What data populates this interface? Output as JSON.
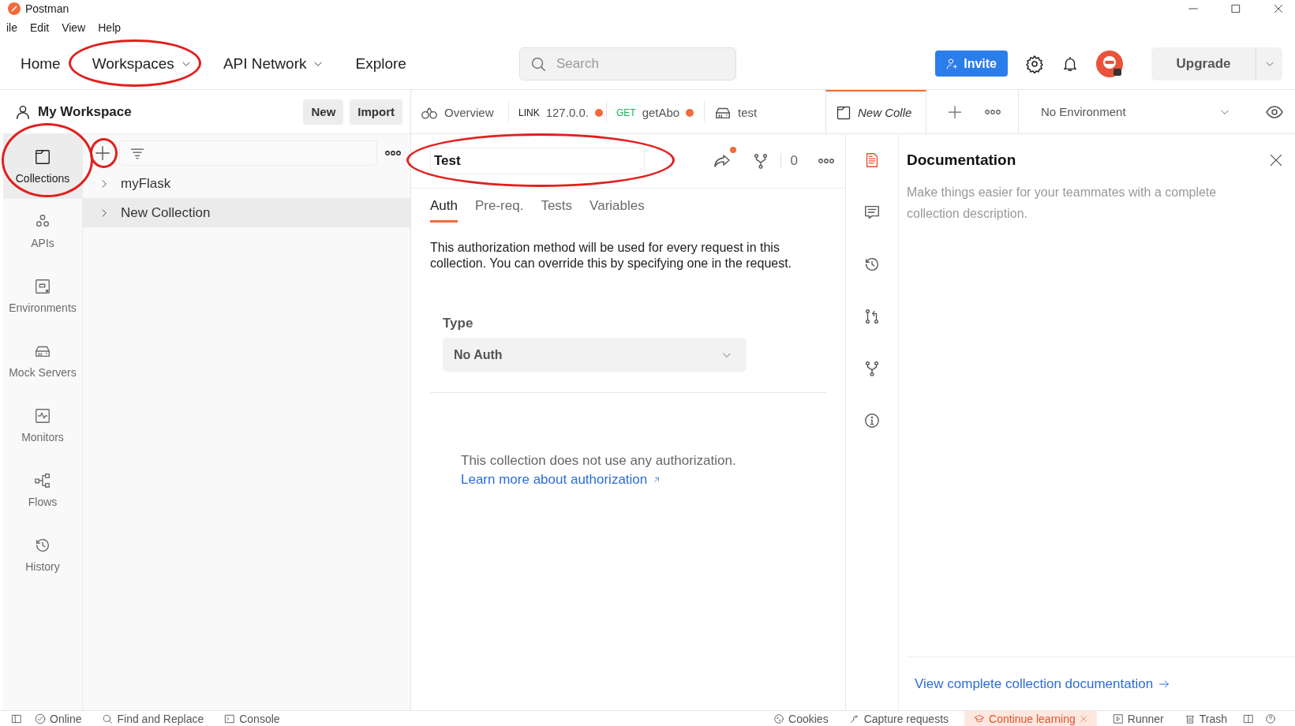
{
  "window": {
    "title": "Postman"
  },
  "menu": [
    "ile",
    "Edit",
    "View",
    "Help"
  ],
  "nav": {
    "items": [
      {
        "label": "Home",
        "dropdown": false,
        "circled": false
      },
      {
        "label": "Workspaces",
        "dropdown": true,
        "circled": true
      },
      {
        "label": "API Network",
        "dropdown": true,
        "circled": false
      },
      {
        "label": "Explore",
        "dropdown": false,
        "circled": false
      }
    ],
    "search": {
      "placeholder": "Search"
    },
    "invite": "Invite",
    "upgrade": "Upgrade"
  },
  "workspace": {
    "name": "My Workspace",
    "buttons": [
      "New",
      "Import"
    ]
  },
  "rail": [
    {
      "kind": "collections",
      "label": "Collections",
      "selected": true,
      "circled": true
    },
    {
      "kind": "apis",
      "label": "APIs",
      "selected": false,
      "circled": false
    },
    {
      "kind": "environments",
      "label": "Environments",
      "selected": false,
      "circled": false
    },
    {
      "kind": "mock",
      "label": "Mock Servers",
      "selected": false,
      "circled": false
    },
    {
      "kind": "monitors",
      "label": "Monitors",
      "selected": false,
      "circled": false
    },
    {
      "kind": "flows",
      "label": "Flows",
      "selected": false,
      "circled": false
    },
    {
      "kind": "history",
      "label": "History",
      "selected": false,
      "circled": false
    }
  ],
  "collections": {
    "add_circled": true,
    "items": [
      {
        "name": "myFlask",
        "selected": false
      },
      {
        "name": "New Collection",
        "selected": true
      }
    ]
  },
  "tabs": [
    {
      "kind": "overview",
      "label": "Overview",
      "selected": false,
      "unsaved": false
    },
    {
      "kind": "request",
      "method": "LINK",
      "color": "#212121",
      "label": "127.0.0.",
      "selected": false,
      "unsaved": true
    },
    {
      "kind": "request",
      "method": "GET",
      "color": "#0cbb52",
      "label": "getAbo",
      "selected": false,
      "unsaved": true
    },
    {
      "kind": "mock",
      "label": "test",
      "selected": false,
      "unsaved": false
    },
    {
      "kind": "collection",
      "label": "New Colle",
      "selected": true,
      "unsaved": false
    }
  ],
  "environment": "No Environment",
  "editor": {
    "title": "Test",
    "title_circled": true,
    "share_unsaved": true,
    "fork_count": "0",
    "subtabs": [
      {
        "label": "Auth",
        "selected": true
      },
      {
        "label": "Pre-req.",
        "selected": false
      },
      {
        "label": "Tests",
        "selected": false
      },
      {
        "label": "Variables",
        "selected": false
      }
    ],
    "description": "This authorization method will be used for every request in this collection. You can override this by specifying one in the request.",
    "type_label": "Type",
    "type_value": "No Auth",
    "note": "This collection does not use any authorization.",
    "link": "Learn more about authorization"
  },
  "side_panel": {
    "icons": [
      {
        "kind": "documentation",
        "selected": true
      },
      {
        "kind": "comments",
        "selected": false
      },
      {
        "kind": "history",
        "selected": false
      },
      {
        "kind": "pull-request",
        "selected": false
      },
      {
        "kind": "fork",
        "selected": false
      },
      {
        "kind": "info",
        "selected": false
      }
    ],
    "title": "Documentation",
    "description": "Make things easier for your teammates with a complete collection description.",
    "link": "View complete collection documentation"
  },
  "status_bar": [
    {
      "kind": "online",
      "label": "Online",
      "highlighted": false
    },
    {
      "kind": "find",
      "label": "Find and Replace",
      "highlighted": false
    },
    {
      "kind": "console",
      "label": "Console",
      "highlighted": false
    },
    {
      "kind": "cookies",
      "label": "Cookies",
      "highlighted": false
    },
    {
      "kind": "capture",
      "label": "Capture requests",
      "highlighted": false
    },
    {
      "kind": "learning",
      "label": "Continue learning",
      "highlighted": true
    },
    {
      "kind": "runner",
      "label": "Runner",
      "highlighted": false
    },
    {
      "kind": "trash",
      "label": "Trash",
      "highlighted": false
    }
  ]
}
